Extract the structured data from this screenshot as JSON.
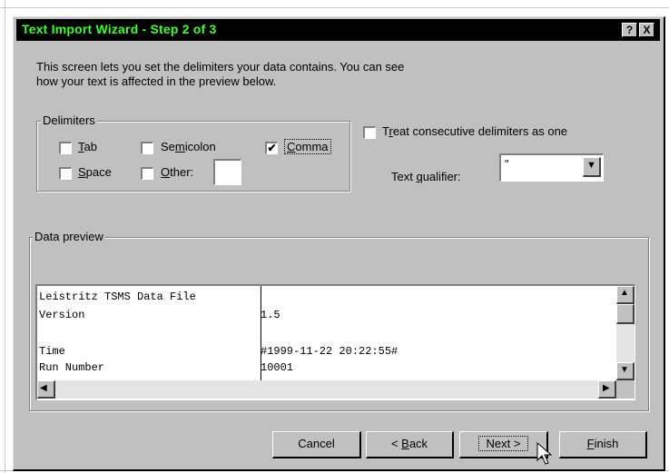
{
  "window": {
    "title": "Text Import Wizard - Step 2 of 3",
    "help_label": "?",
    "close_label": "X"
  },
  "description": {
    "line1": "This screen lets you set the delimiters your data contains.  You can see",
    "line2": "how your text is affected in the preview below."
  },
  "delimiters": {
    "legend": "Delimiters",
    "tab": {
      "pre": "",
      "mn": "T",
      "post": "ab",
      "checked": false
    },
    "semicolon": {
      "pre": "Se",
      "mn": "m",
      "post": "icolon",
      "checked": false
    },
    "comma": {
      "pre": "",
      "mn": "C",
      "post": "omma",
      "checked": true
    },
    "space": {
      "pre": "",
      "mn": "S",
      "post": "pace",
      "checked": false
    },
    "other": {
      "pre": "",
      "mn": "O",
      "post": "ther:",
      "checked": false,
      "value": ""
    }
  },
  "consecutive": {
    "pre": "T",
    "mn": "r",
    "post": "eat consecutive delimiters as one",
    "checked": false
  },
  "qualifier": {
    "pre": "Text ",
    "mn": "q",
    "post": "ualifier:",
    "value": "\""
  },
  "preview": {
    "legend": "Data preview",
    "rows": [
      [
        "Leistritz TSMS Data File",
        ""
      ],
      [
        "Version",
        "1.5"
      ],
      [
        "",
        ""
      ],
      [
        "Time",
        "#1999-11-22 20:22:55#"
      ],
      [
        "Run Number",
        "10001"
      ]
    ]
  },
  "buttons": {
    "cancel": "Cancel",
    "back": {
      "pre": "< ",
      "mn": "B",
      "post": "ack"
    },
    "next": "Next >",
    "finish": {
      "pre": "",
      "mn": "F",
      "post": "inish"
    }
  },
  "glyphs": {
    "check": "✔",
    "arrow_up": "▲",
    "arrow_down": "▼",
    "arrow_left": "◀",
    "arrow_right": "▶"
  },
  "icons": {
    "pointer": "mouse-pointer-icon"
  }
}
